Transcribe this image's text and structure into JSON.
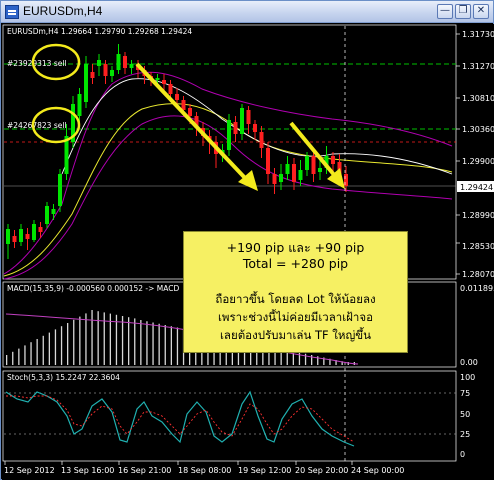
{
  "window": {
    "title": "EURUSDm,H4"
  },
  "chart": {
    "header": "EURUSDm,H4  1.29664 1.29790 1.29268 1.29424",
    "price_axis": [
      "1.31730",
      "1.31270",
      "1.30810",
      "1.30360",
      "1.29900",
      "1.29424",
      "1.28990",
      "1.28530",
      "1.28070"
    ],
    "current_price": "1.29424",
    "orders": [
      {
        "label": "#23929313 sell"
      },
      {
        "label": "#24267823 sell"
      }
    ],
    "time_axis": [
      "12 Sep 2012",
      "13 Sep 16:00",
      "16 Sep 21:00",
      "18 Sep 08:00",
      "19 Sep 12:00",
      "20 Sep 20:00",
      "24 Sep 00:00"
    ]
  },
  "macd": {
    "header": "MACD(15,35,9) -0.000560 0.000152 -> MACD",
    "axis": [
      "0.011895",
      "0.00"
    ]
  },
  "stoch": {
    "header": "Stoch(5,3,3) 15.2247 22.3604",
    "axis": [
      "100",
      "75",
      "50",
      "25",
      "0"
    ]
  },
  "note": {
    "line1": "+190 pip และ +90 pip",
    "line2": "Total = +280 pip",
    "line3": "ถือยาวขึ้น โดยลด Lot ให้น้อยลง",
    "line4": "เพราะช่วงนี้ไม่ค่อยมีเวลาเฝ้าจอ",
    "line5": "เลยต้องปรับมาเล่น TF ใหญ่ขึ้น"
  },
  "colors": {
    "background": "#000000",
    "bull_candle": "#00e600",
    "bear_candle": "#ff2020",
    "order_line": "#00c000",
    "highlight_circle": "#f3ea1c",
    "arrow": "#f3ea1c",
    "macd_hist": "#d8d8d8",
    "macd_signal": "#c040c0",
    "stoch_main": "#20b0b0",
    "stoch_signal": "#ff3030",
    "band_outer": "#b000b0",
    "band_mid": "#e8e830"
  }
}
